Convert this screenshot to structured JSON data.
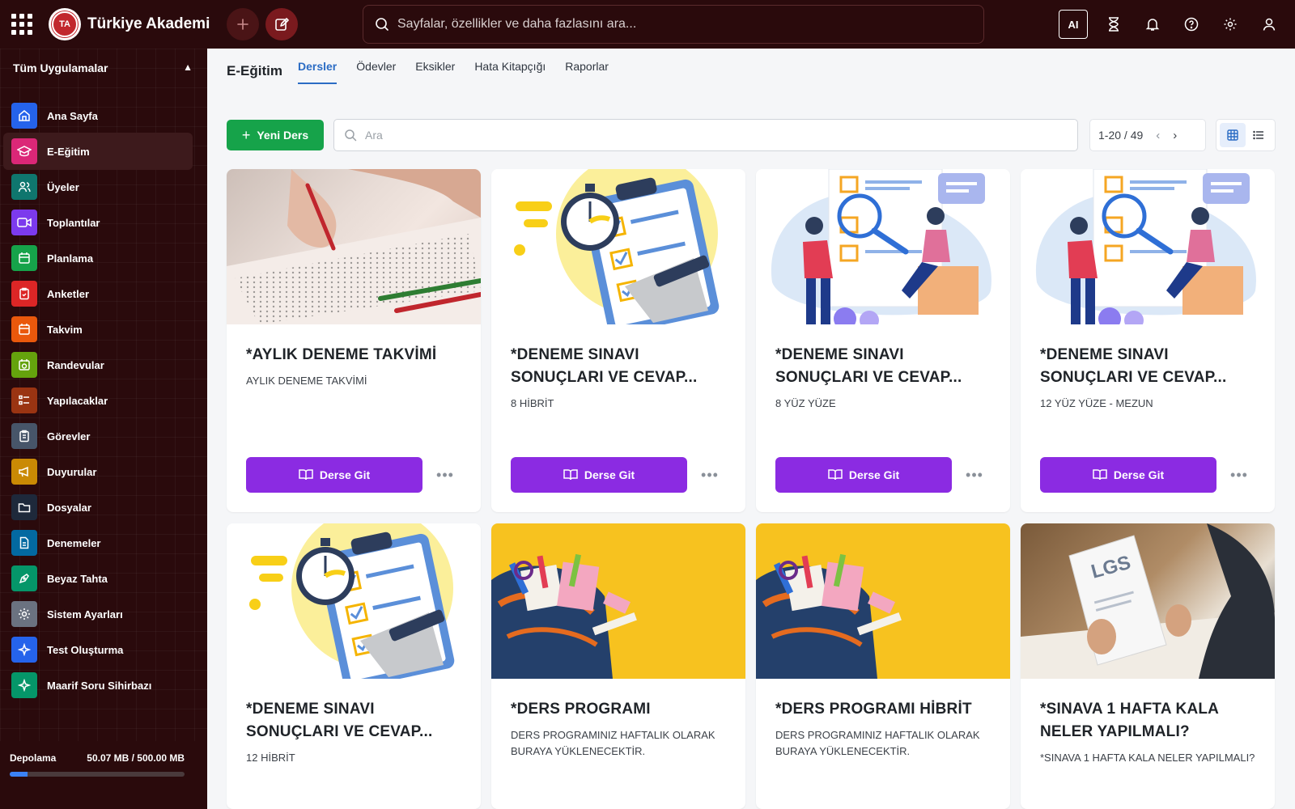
{
  "app": {
    "brand": "Türkiye Akademi",
    "logo_text": "TA"
  },
  "topbar": {
    "search_placeholder": "Sayfalar, özellikler ve daha fazlasını ara...",
    "ai_label": "AI",
    "icons": [
      "apps-grid-icon",
      "plus-icon",
      "edit-icon",
      "search-icon",
      "hourglass-icon",
      "bell-icon",
      "help-icon",
      "settings-icon",
      "user-icon"
    ]
  },
  "sidebar": {
    "header": "Tüm Uygulamalar",
    "items": [
      {
        "label": "Ana Sayfa",
        "icon": "home-icon",
        "color": "#2563eb"
      },
      {
        "label": "E-Eğitim",
        "icon": "graduation-cap-icon",
        "color": "#db2777"
      },
      {
        "label": "Üyeler",
        "icon": "users-icon",
        "color": "#0f766e"
      },
      {
        "label": "Toplantılar",
        "icon": "video-icon",
        "color": "#7c3aed"
      },
      {
        "label": "Planlama",
        "icon": "calendar-icon",
        "color": "#16a34a"
      },
      {
        "label": "Anketler",
        "icon": "clipboard-icon",
        "color": "#dc2626"
      },
      {
        "label": "Takvim",
        "icon": "calendar-icon",
        "color": "#ea580c"
      },
      {
        "label": "Randevular",
        "icon": "calendar-clock-icon",
        "color": "#65a30d"
      },
      {
        "label": "Yapılacaklar",
        "icon": "checklist-icon",
        "color": "#9a3412"
      },
      {
        "label": "Görevler",
        "icon": "clipboard-list-icon",
        "color": "#475569"
      },
      {
        "label": "Duyurular",
        "icon": "megaphone-icon",
        "color": "#ca8a04"
      },
      {
        "label": "Dosyalar",
        "icon": "folder-icon",
        "color": "#1e293b"
      },
      {
        "label": "Denemeler",
        "icon": "document-icon",
        "color": "#0369a1"
      },
      {
        "label": "Beyaz Tahta",
        "icon": "pen-icon",
        "color": "#059669"
      },
      {
        "label": "Sistem Ayarları",
        "icon": "gear-icon",
        "color": "#6b7280"
      },
      {
        "label": "Test Oluşturma",
        "icon": "sparkle-icon",
        "color": "#2563eb"
      },
      {
        "label": "Maarif Soru Sihirbazı",
        "icon": "sparkle-icon",
        "color": "#059669"
      }
    ],
    "storage": {
      "label": "Depolama",
      "value": "50.07 MB / 500.00 MB",
      "used_fraction": 0.1
    }
  },
  "main": {
    "title": "E-Eğitim",
    "tabs": [
      "Dersler",
      "Ödevler",
      "Eksikler",
      "Hata Kitapçığı",
      "Raporlar"
    ],
    "active_tab": 0,
    "new_button": "Yeni Ders",
    "search_placeholder": "Ara",
    "pager": "1-20 / 49",
    "go_label": "Derse Git",
    "cards": [
      {
        "title": "*AYLIK DENEME TAKVİMİ",
        "subtitle": "AYLIK DENEME TAKVİMİ",
        "image": "exam-sheet-photo"
      },
      {
        "title": "*DENEME SINAVI SONUÇLARI VE CEVAP...",
        "subtitle": "8 HİBRİT",
        "image": "stopwatch-clipboard-illustration"
      },
      {
        "title": "*DENEME SINAVI SONUÇLARI VE CEVAP...",
        "subtitle": "8 YÜZ YÜZE",
        "image": "people-magnifier-illustration"
      },
      {
        "title": "*DENEME SINAVI SONUÇLARI VE CEVAP...",
        "subtitle": "12 YÜZ YÜZE - MEZUN",
        "image": "people-magnifier-illustration"
      },
      {
        "title": "*DENEME SINAVI SONUÇLARI VE CEVAP...",
        "subtitle": "12 HİBRİT",
        "image": "stopwatch-clipboard-illustration"
      },
      {
        "title": "*DERS PROGRAMI",
        "subtitle": "DERS PROGRAMINIZ HAFTALIK OLARAK BURAYA YÜKLENECEKTİR.",
        "image": "school-backpack-photo"
      },
      {
        "title": "*DERS PROGRAMI HİBRİT",
        "subtitle": "DERS PROGRAMINIZ HAFTALIK OLARAK BURAYA YÜKLENECEKTİR.",
        "image": "school-backpack-photo"
      },
      {
        "title": "*SINAVA 1 HAFTA KALA NELER YAPILMALI?",
        "subtitle": "*SINAVA 1 HAFTA KALA NELER YAPILMALI?",
        "image": "lgs-exam-photo",
        "image_text": "LGS"
      }
    ]
  }
}
